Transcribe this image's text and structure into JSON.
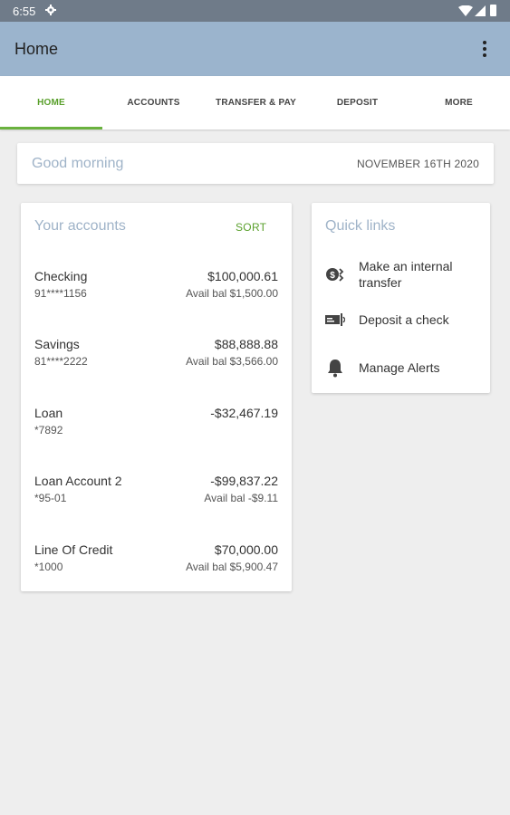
{
  "status_bar": {
    "time": "6:55"
  },
  "app_bar": {
    "title": "Home"
  },
  "tabs": [
    {
      "label": "HOME",
      "active": true
    },
    {
      "label": "ACCOUNTS",
      "active": false
    },
    {
      "label": "TRANSFER & PAY",
      "active": false
    },
    {
      "label": "DEPOSIT",
      "active": false
    },
    {
      "label": "MORE",
      "active": false
    }
  ],
  "greeting": {
    "text": "Good morning",
    "date": "NOVEMBER 16TH 2020"
  },
  "accounts": {
    "title": "Your accounts",
    "sort_label": "SORT",
    "items": [
      {
        "name": "Checking",
        "number": "91****1156",
        "balance": "$100,000.61",
        "available": "Avail bal $1,500.00"
      },
      {
        "name": "Savings",
        "number": "81****2222",
        "balance": "$88,888.88",
        "available": "Avail bal $3,566.00"
      },
      {
        "name": "Loan",
        "number": "*7892",
        "balance": "-$32,467.19",
        "available": ""
      },
      {
        "name": "Loan Account 2",
        "number": "*95-01",
        "balance": "-$99,837.22",
        "available": "Avail bal -$9.11"
      },
      {
        "name": "Line Of Credit",
        "number": "*1000",
        "balance": "$70,000.00",
        "available": "Avail bal $5,900.47"
      }
    ]
  },
  "quick_links": {
    "title": "Quick links",
    "items": [
      {
        "label": "Make an internal transfer",
        "icon": "transfer-icon"
      },
      {
        "label": "Deposit a check",
        "icon": "check-deposit-icon"
      },
      {
        "label": "Manage Alerts",
        "icon": "bell-icon"
      }
    ]
  },
  "colors": {
    "app_bar": "#9bb4cd",
    "status_bar": "#6f7b89",
    "accent_green": "#5aa02c",
    "muted_blue": "#9fb3c8"
  }
}
